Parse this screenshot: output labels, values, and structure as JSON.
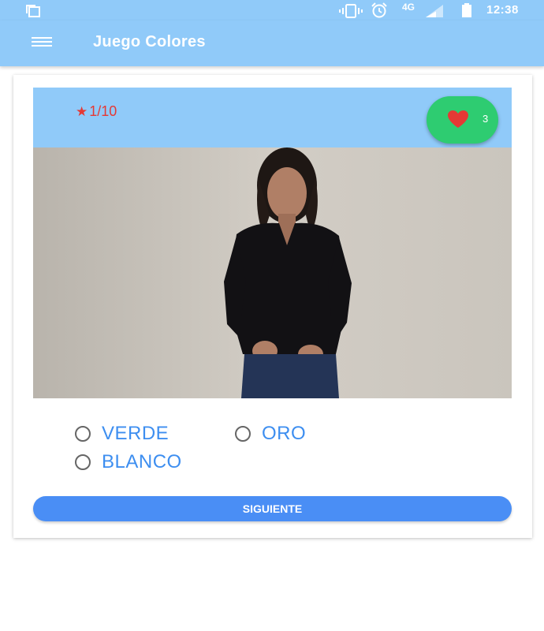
{
  "status_bar": {
    "time": "12:38",
    "network": "4G",
    "icons": [
      "copy-icon",
      "vibrate-icon",
      "alarm-icon",
      "signal-icon",
      "battery-icon"
    ]
  },
  "app_bar": {
    "title": "Juego Colores",
    "menu_icon": "menu-icon"
  },
  "game": {
    "progress": "1/10",
    "lives": "3",
    "options": [
      "VERDE",
      "ORO",
      "BLANCO"
    ],
    "next_button_label": "SIGUIENTE"
  },
  "colors": {
    "primary_light": "#90caf9",
    "lives_fab": "#2ecc71",
    "heart": "#e53935",
    "option_text": "#3d8ef0",
    "button": "#4a8ef5"
  }
}
